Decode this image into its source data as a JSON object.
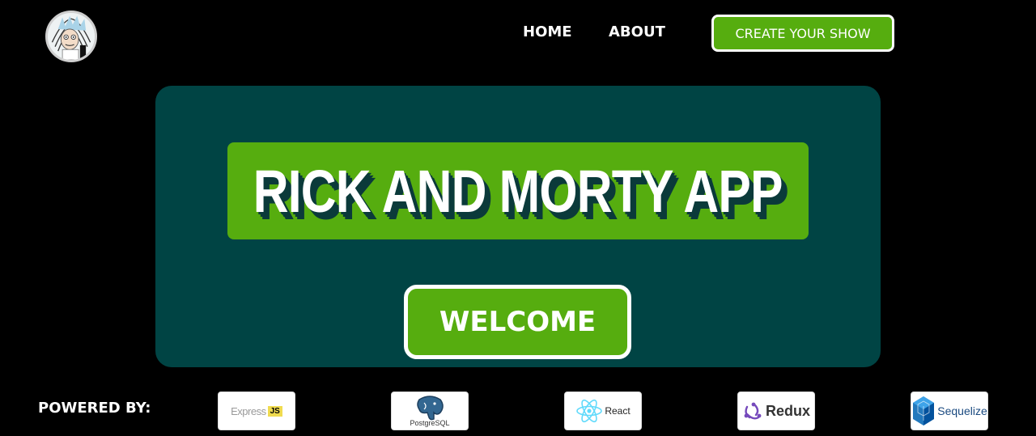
{
  "header": {
    "logo_icon": "rick-sanchez-avatar-icon",
    "nav": {
      "home_label": "HOME",
      "about_label": "ABOUT"
    },
    "cta_label": "CREATE YOUR SHOW"
  },
  "hero": {
    "title": "RICK AND MORTY APP",
    "welcome_label": "WELCOME"
  },
  "footer": {
    "powered_label": "POWERED BY:",
    "technologies": {
      "express": {
        "text": "Express",
        "badge": "JS",
        "icon": "express-js-logo-icon"
      },
      "postgres": {
        "text": "PostgreSQL",
        "icon": "postgresql-elephant-icon"
      },
      "react": {
        "text": "React",
        "icon": "react-atom-icon"
      },
      "redux": {
        "text": "Redux",
        "icon": "redux-logo-icon"
      },
      "sequelize": {
        "text": "Sequelize",
        "icon": "sequelize-cube-icon"
      }
    }
  },
  "colors": {
    "background": "#000000",
    "accent_green": "#56ad0f",
    "hero_teal": "#004444",
    "title_shadow": "#0b3a3a",
    "text": "#ffffff"
  }
}
